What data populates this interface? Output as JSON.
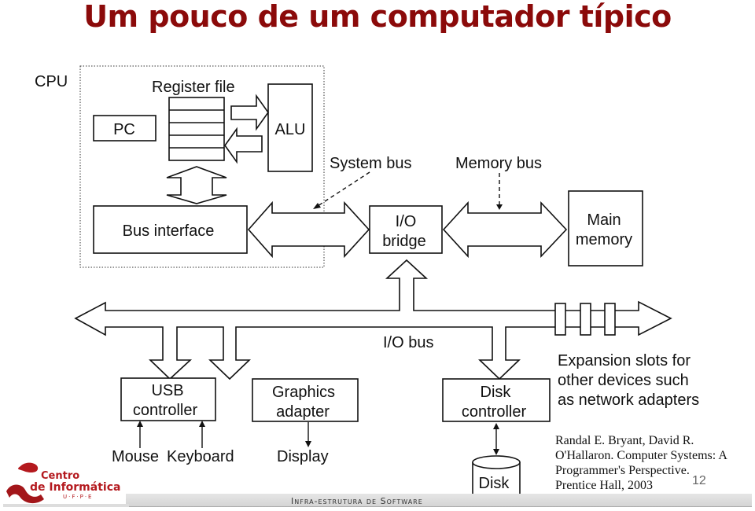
{
  "slide": {
    "title": "Um pouco de um computador típico",
    "slide_number": "12",
    "footer": "Infra-estrutura de Software",
    "title_color": "#8b0a0a"
  },
  "logo": {
    "line1": "Centro",
    "line2": "de Informática",
    "line3": "U·F·P·E"
  },
  "diagram": {
    "cpu_label": "CPU",
    "register_file": "Register file",
    "pc": "PC",
    "alu": "ALU",
    "bus_interface": "Bus interface",
    "system_bus": "System bus",
    "memory_bus": "Memory bus",
    "io_bridge_line1": "I/O",
    "io_bridge_line2": "bridge",
    "main_memory_line1": "Main",
    "main_memory_line2": "memory",
    "io_bus": "I/O bus",
    "usb_line1": "USB",
    "usb_line2": "controller",
    "graphics_line1": "Graphics",
    "graphics_line2": "adapter",
    "disk_ctrl_line1": "Disk",
    "disk_ctrl_line2": "controller",
    "expansion_line1": "Expansion slots for",
    "expansion_line2": "other devices such",
    "expansion_line3": "as network adapters",
    "mouse": "Mouse",
    "keyboard": "Keyboard",
    "display": "Display",
    "disk": "Disk"
  },
  "citation": {
    "line1": "Randal E. Bryant, David R.",
    "line2": "O'Hallaron. Computer Systems: A",
    "line3": "Programmer's Perspective.",
    "line4": "Prentice Hall, 2003"
  }
}
